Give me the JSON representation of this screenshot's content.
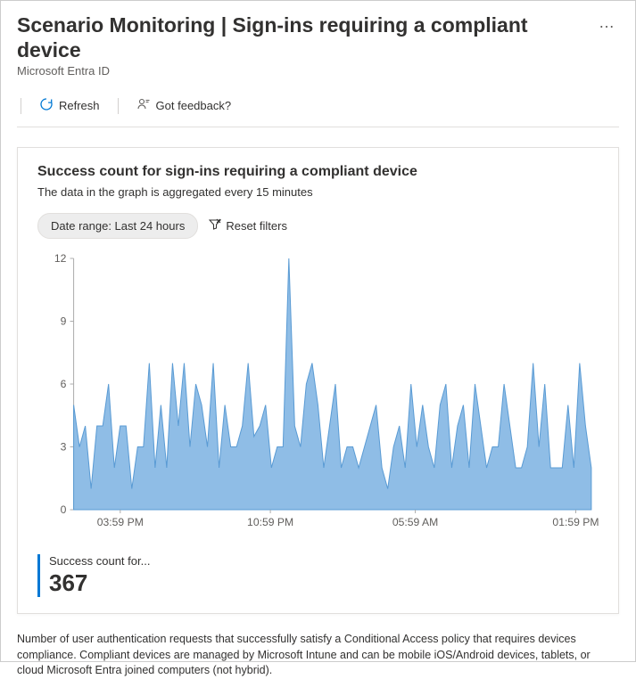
{
  "header": {
    "title": "Scenario Monitoring | Sign-ins requiring a compliant device",
    "subtitle": "Microsoft Entra ID"
  },
  "toolbar": {
    "refresh_label": "Refresh",
    "feedback_label": "Got feedback?"
  },
  "card": {
    "title": "Success count for sign-ins requiring a compliant device",
    "subtitle": "The data in the graph is aggregated every 15 minutes",
    "date_range_label": "Date range: Last 24 hours",
    "reset_label": "Reset filters",
    "kpi_label": "Success count for...",
    "kpi_value": "367"
  },
  "footnote": "Number of user authentication requests that successfully satisfy a Conditional Access policy that requires devices compliance. Compliant devices are managed by Microsoft Intune and can be mobile iOS/Android devices, tablets, or cloud Microsoft Entra joined computers (not hybrid).",
  "chart_data": {
    "type": "area",
    "title": "Success count for sign-ins requiring a compliant device",
    "xlabel": "",
    "ylabel": "",
    "ylim": [
      0,
      12
    ],
    "y_ticks": [
      0,
      3,
      6,
      9,
      12
    ],
    "x_tick_labels": [
      "03:59 PM",
      "10:59 PM",
      "05:59 AM",
      "01:59 PM"
    ],
    "x_tick_positions": [
      0.09,
      0.38,
      0.66,
      0.97
    ],
    "values": [
      5,
      3,
      4,
      1,
      4,
      4,
      6,
      2,
      4,
      4,
      1,
      3,
      3,
      7,
      2,
      5,
      2,
      7,
      4,
      7,
      3,
      6,
      5,
      3,
      7,
      2,
      5,
      3,
      3,
      4,
      7,
      3.5,
      4,
      5,
      2,
      3,
      3,
      12,
      4,
      3,
      6,
      7,
      5,
      2,
      4,
      6,
      2,
      3,
      3,
      2,
      3,
      4,
      5,
      2,
      1,
      3,
      4,
      2,
      6,
      3,
      5,
      3,
      2,
      5,
      6,
      2,
      4,
      5,
      2,
      6,
      4,
      2,
      3,
      3,
      6,
      4,
      2,
      2,
      3,
      7,
      3,
      6,
      2,
      2,
      2,
      5,
      2,
      7,
      4,
      2
    ]
  }
}
